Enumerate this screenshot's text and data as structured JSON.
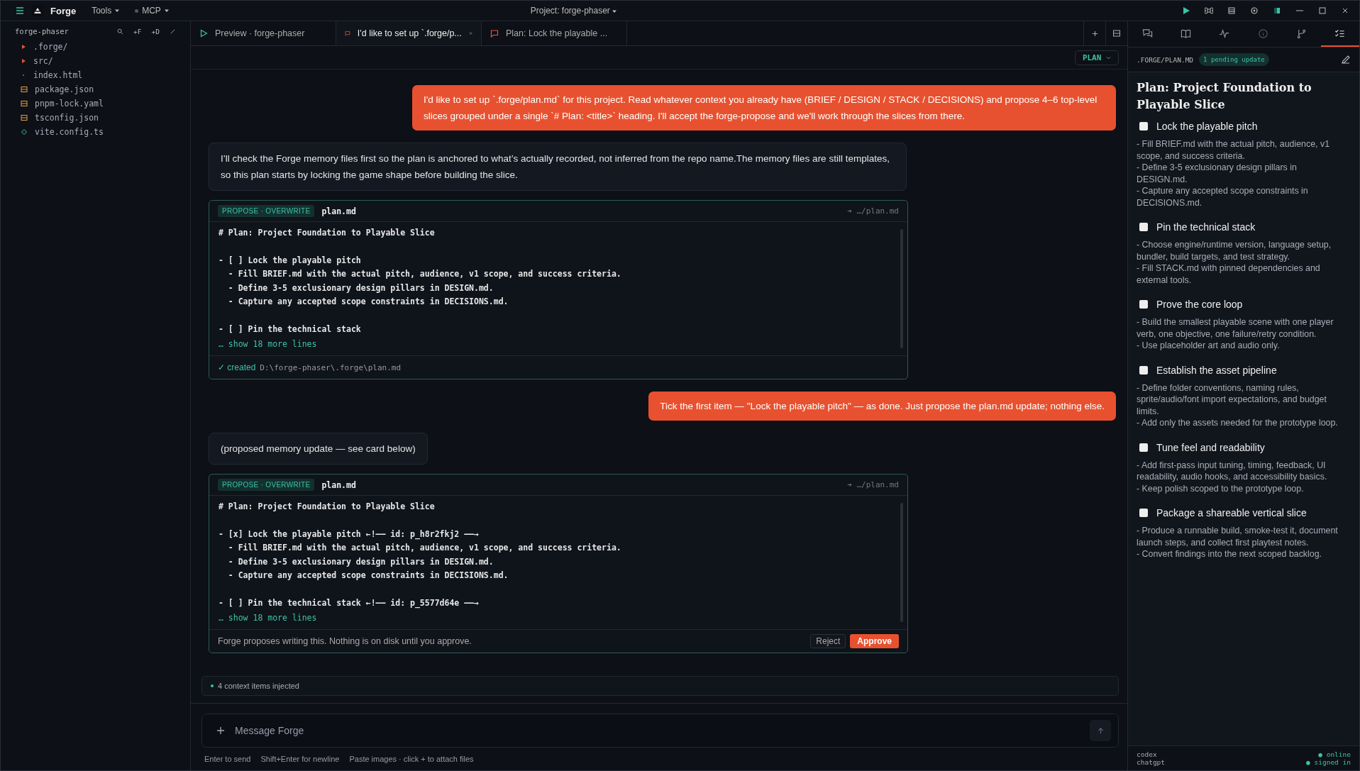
{
  "menubar": {
    "app": "Forge",
    "menus": [
      {
        "label": "Tools",
        "kind": "menu"
      },
      {
        "label": "MCP",
        "kind": "status"
      }
    ],
    "project": "Project: forge-phaser"
  },
  "sidebar": {
    "title": "forge-phaser",
    "actions": [
      "+F",
      "+D"
    ],
    "files": [
      {
        "name": ".forge/",
        "kind": "folder"
      },
      {
        "name": "src/",
        "kind": "folder"
      },
      {
        "name": "index.html",
        "kind": "file"
      },
      {
        "name": "package.json",
        "kind": "data"
      },
      {
        "name": "pnpm-lock.yaml",
        "kind": "data"
      },
      {
        "name": "tsconfig.json",
        "kind": "data"
      },
      {
        "name": "vite.config.ts",
        "kind": "config"
      }
    ]
  },
  "tabs": [
    {
      "label": "Preview · forge-phaser",
      "kind": "preview",
      "selected": false
    },
    {
      "label": "I'd like to set up `.forge/p...",
      "kind": "chat",
      "selected": true
    },
    {
      "label": "Plan: Lock the playable ...",
      "kind": "chat",
      "selected": false
    }
  ],
  "mode": "PLAN",
  "messages": [
    {
      "kind": "user",
      "text": "I'd like to set up `.forge/plan.md` for this project. Read whatever context you already have (BRIEF / DESIGN / STACK / DECISIONS) and propose 4–6 top-level slices grouped under a single `# Plan: <title>` heading. I'll accept the forge-propose and we'll work through the slices from there."
    },
    {
      "kind": "assistant",
      "text": "I’ll check the Forge memory files first so the plan is anchored to what’s actually recorded, not inferred from the repo name.The memory files are still templates, so this plan starts by locking the game shape before building the slice."
    },
    {
      "kind": "card",
      "badge": "PROPOSE · OVERWRITE",
      "file": "plan.md",
      "path": "➔ …/plan.md",
      "blocks": [
        [
          "# Plan: Project Foundation to Playable Slice"
        ],
        [
          "- [ ] Lock the playable pitch",
          "  - Fill BRIEF.md with the actual pitch, audience, v1 scope, and success criteria.",
          "  - Define 3-5 exclusionary design pillars in DESIGN.md.",
          "  - Capture any accepted scope constraints in DECISIONS.md."
        ],
        [
          "- [ ] Pin the technical stack"
        ]
      ],
      "more": "… show 18 more lines",
      "footer": {
        "kind": "created",
        "status": "✓ created",
        "path": "D:\\forge-phaser\\.forge\\plan.md"
      }
    },
    {
      "kind": "user",
      "text": "Tick the first item — \"Lock the playable pitch\" — as done. Just propose the plan.md update; nothing else."
    },
    {
      "kind": "assistant",
      "text": "(proposed memory update — see card below)"
    },
    {
      "kind": "card",
      "badge": "PROPOSE · OVERWRITE",
      "file": "plan.md",
      "path": "➔ …/plan.md",
      "blocks": [
        [
          "# Plan: Project Foundation to Playable Slice"
        ],
        [
          "- [x] Lock the playable pitch ←!—— id: p_h8r2fkj2 ——→",
          "  - Fill BRIEF.md with the actual pitch, audience, v1 scope, and success criteria.",
          "  - Define 3-5 exclusionary design pillars in DESIGN.md.",
          "  - Capture any accepted scope constraints in DECISIONS.md."
        ],
        [
          "- [ ] Pin the technical stack ←!—— id: p_5577d64e ——→"
        ]
      ],
      "more": "… show 18 more lines",
      "footer": {
        "kind": "pending",
        "note": "Forge proposes writing this. Nothing is on disk until you approve.",
        "reject": "Reject",
        "approve": "Approve"
      }
    }
  ],
  "context": "4 context items injected",
  "composer": {
    "placeholder": "Message Forge",
    "hints": [
      "Enter to send",
      "Shift+Enter for newline",
      "Paste images · click + to attach files"
    ]
  },
  "panel": {
    "tabs": [
      {
        "kind": "chat",
        "selected": false
      },
      {
        "kind": "book",
        "selected": false
      },
      {
        "kind": "pulse",
        "selected": false
      },
      {
        "kind": "info",
        "selected": false
      },
      {
        "kind": "branch",
        "selected": false
      },
      {
        "kind": "checklist",
        "selected": true
      }
    ],
    "path": ".FORGE/PLAN.MD",
    "pending": "1 pending update",
    "title": "Plan: Project Foundation to Playable Slice",
    "items": [
      {
        "title": "Lock the playable pitch",
        "checked": false,
        "notes": [
          "- Fill BRIEF.md with the actual pitch, audience, v1 scope, and success criteria.",
          "- Define 3-5 exclusionary design pillars in DESIGN.md.",
          "- Capture any accepted scope constraints in DECISIONS.md."
        ]
      },
      {
        "title": "Pin the technical stack",
        "checked": false,
        "notes": [
          "- Choose engine/runtime version, language setup, bundler, build targets, and test strategy.",
          "- Fill STACK.md with pinned dependencies and external tools."
        ]
      },
      {
        "title": "Prove the core loop",
        "checked": false,
        "notes": [
          "- Build the smallest playable scene with one player verb, one objective, one failure/retry condition.",
          "- Use placeholder art and audio only."
        ]
      },
      {
        "title": "Establish the asset pipeline",
        "checked": false,
        "notes": [
          "- Define folder conventions, naming rules, sprite/audio/font import expectations, and budget limits.",
          "- Add only the assets needed for the prototype loop."
        ]
      },
      {
        "title": "Tune feel and readability",
        "checked": false,
        "notes": [
          "- Add first-pass input tuning, timing, feedback, UI readability, audio hooks, and accessibility basics.",
          "- Keep polish scoped to the prototype loop."
        ]
      },
      {
        "title": "Package a shareable vertical slice",
        "checked": false,
        "notes": [
          "- Produce a runnable build, smoke-test it, document launch steps, and collect first playtest notes.",
          "- Convert findings into the next scoped backlog."
        ]
      }
    ],
    "status": [
      {
        "name": "codex",
        "state": "● online"
      },
      {
        "name": "chatgpt",
        "state": "● signed in"
      }
    ]
  }
}
